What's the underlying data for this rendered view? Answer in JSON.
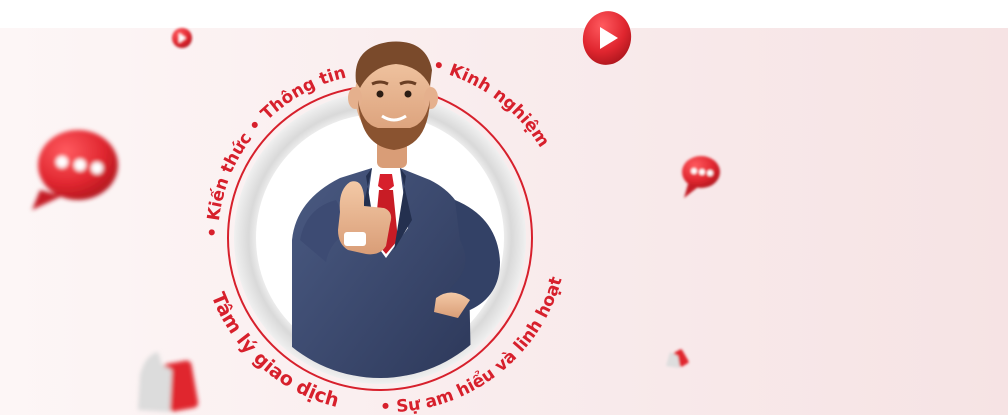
{
  "banner": {
    "ring_labels": {
      "top_left": "• Kiến thức • Thông tin",
      "top_right": "• Kinh nghiệm",
      "bottom_left": "Tâm lý giao dịch",
      "bottom_right": "• Sự am hiểu và linh hoạt"
    },
    "accent_color": "#d7202c",
    "background_color": "#f8e9ea",
    "icons": [
      "play-button-icon",
      "chat-bubble-icon",
      "thumbs-up-icon"
    ],
    "illustration": "businessman-thumbs-up"
  }
}
